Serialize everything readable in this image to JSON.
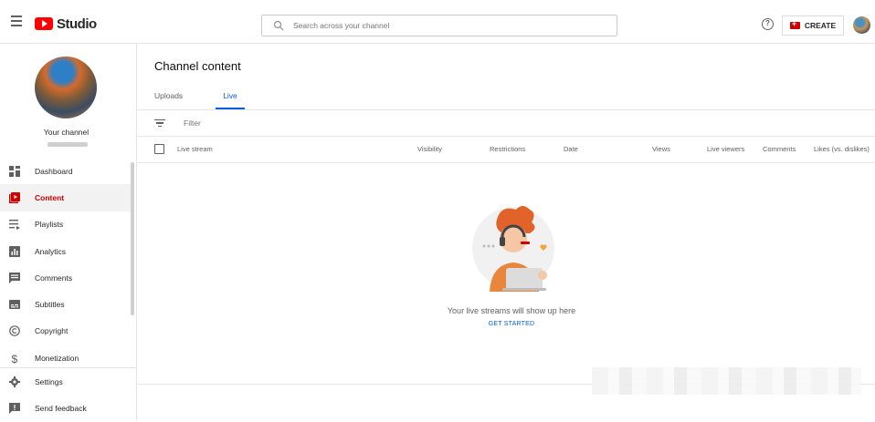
{
  "header": {
    "logo_text": "Studio",
    "search_placeholder": "Search across your channel",
    "create_label": "CREATE"
  },
  "sidebar": {
    "channel_label": "Your channel",
    "items": [
      {
        "label": "Dashboard",
        "icon": "dashboard-icon"
      },
      {
        "label": "Content",
        "icon": "content-icon",
        "active": true
      },
      {
        "label": "Playlists",
        "icon": "playlists-icon"
      },
      {
        "label": "Analytics",
        "icon": "analytics-icon"
      },
      {
        "label": "Comments",
        "icon": "comments-icon"
      },
      {
        "label": "Subtitles",
        "icon": "subtitles-icon"
      },
      {
        "label": "Copyright",
        "icon": "copyright-icon"
      },
      {
        "label": "Monetization",
        "icon": "monetization-icon"
      }
    ],
    "bottom_items": [
      {
        "label": "Settings",
        "icon": "gear-icon"
      },
      {
        "label": "Send feedback",
        "icon": "feedback-icon"
      }
    ]
  },
  "main": {
    "title": "Channel content",
    "tabs": [
      {
        "label": "Uploads"
      },
      {
        "label": "Live",
        "active": true
      }
    ],
    "filter_placeholder": "Filter",
    "columns": [
      "Live stream",
      "Visibility",
      "Restrictions",
      "Date",
      "Views",
      "Live viewers",
      "Comments",
      "Likes (vs. dislikes)"
    ],
    "empty_message": "Your live streams will show up here",
    "get_started_label": "GET STARTED"
  },
  "colors": {
    "accent_red": "#cc0000",
    "link_blue": "#065fd4"
  }
}
